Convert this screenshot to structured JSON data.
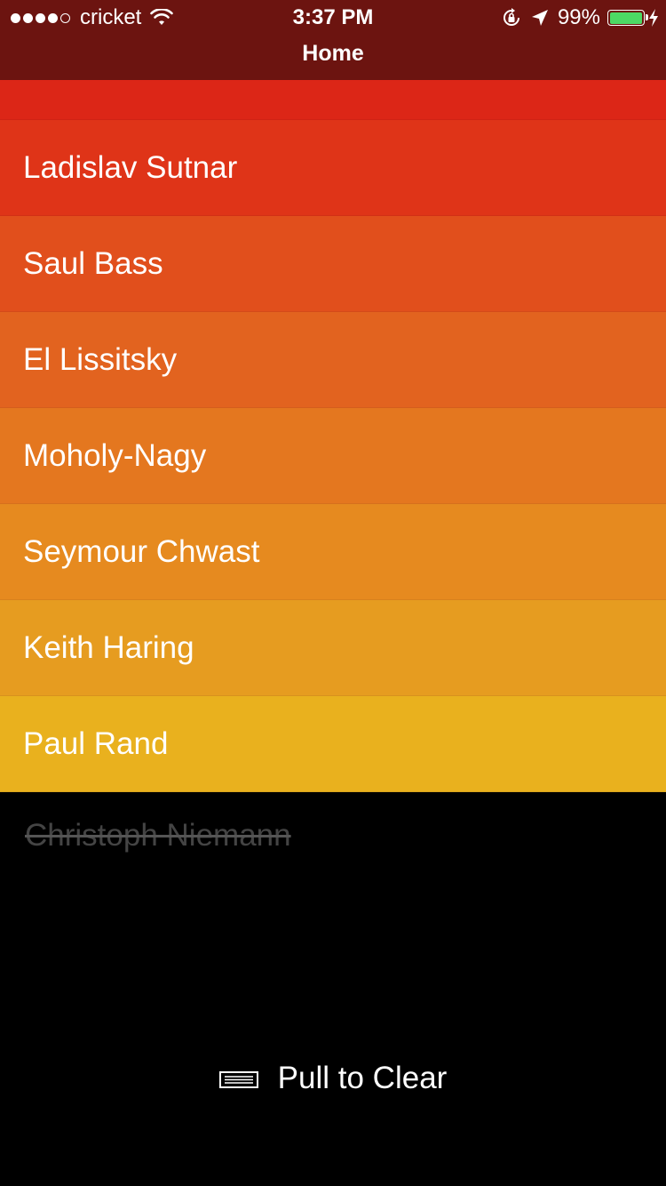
{
  "status_bar": {
    "carrier": "cricket",
    "time": "3:37 PM",
    "battery_percent": "99%",
    "battery_level": 0.99,
    "signal_bars_filled": 4,
    "signal_bars_total": 5
  },
  "nav": {
    "title": "Home"
  },
  "items": [
    {
      "label": "Ladislav Sutnar",
      "color": "#df3418"
    },
    {
      "label": "Saul Bass",
      "color": "#e14f1c"
    },
    {
      "label": "El Lissitsky",
      "color": "#e2631f"
    },
    {
      "label": "Moholy-Nagy",
      "color": "#e4771f"
    },
    {
      "label": "Seymour Chwast",
      "color": "#e68a1f"
    },
    {
      "label": "Keith Haring",
      "color": "#e69c20"
    },
    {
      "label": "Paul Rand",
      "color": "#e9b11e"
    }
  ],
  "completed_items": [
    {
      "label": "Christoph Niemann"
    }
  ],
  "footer": {
    "pull_label": "Pull to Clear"
  },
  "colors": {
    "header_bg": "#6c1410",
    "top_strip": "#dc2617",
    "battery_fill": "#4cd964",
    "background": "#000000"
  },
  "icons": {
    "wifi": "wifi-icon",
    "rotation_lock": "rotation-lock-icon",
    "location": "location-arrow-icon",
    "battery": "battery-icon",
    "charging": "charging-bolt-icon",
    "tray": "tray-icon"
  }
}
